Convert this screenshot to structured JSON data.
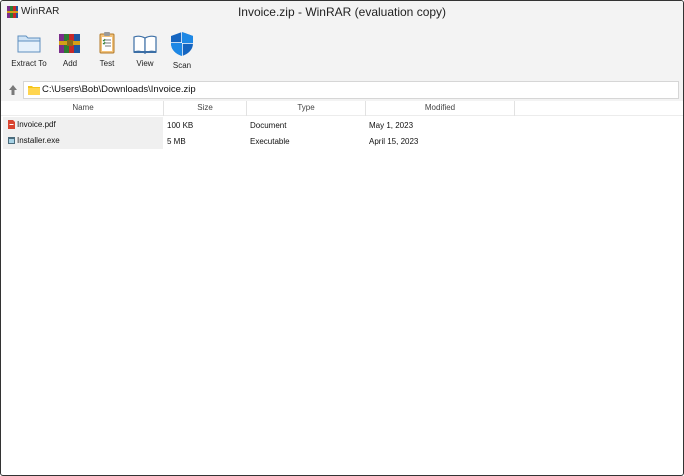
{
  "titlebar": {
    "app_name": "WinRAR",
    "window_title": "Invoice.zip - WinRAR (evaluation copy)"
  },
  "toolbar": {
    "buttons": [
      {
        "label": "Extract To",
        "icon": "extract-folder-icon"
      },
      {
        "label": "Add",
        "icon": "archive-books-icon"
      },
      {
        "label": "Test",
        "icon": "clipboard-checklist-icon"
      },
      {
        "label": "View",
        "icon": "open-book-icon"
      },
      {
        "label": "Scan",
        "icon": "shield-icon"
      }
    ]
  },
  "address": {
    "path": "C:\\Users\\Bob\\Downloads\\Invoice.zip"
  },
  "columns": {
    "name": "Name",
    "size": "Size",
    "type": "Type",
    "modified": "Modified"
  },
  "files": [
    {
      "name": "Invoice.pdf",
      "size": "100 KB",
      "type": "Document",
      "modified": "May 1, 2023",
      "icon": "pdf-file-icon"
    },
    {
      "name": "Installer.exe",
      "size": "5 MB",
      "type": "Executable",
      "modified": "April 15, 2023",
      "icon": "exe-file-icon"
    }
  ],
  "colors": {
    "chrome_bg": "#f3f3f3",
    "shield_blue": "#1565c0",
    "folder_yellow": "#f5c518",
    "pdf_red": "#d9442f"
  }
}
